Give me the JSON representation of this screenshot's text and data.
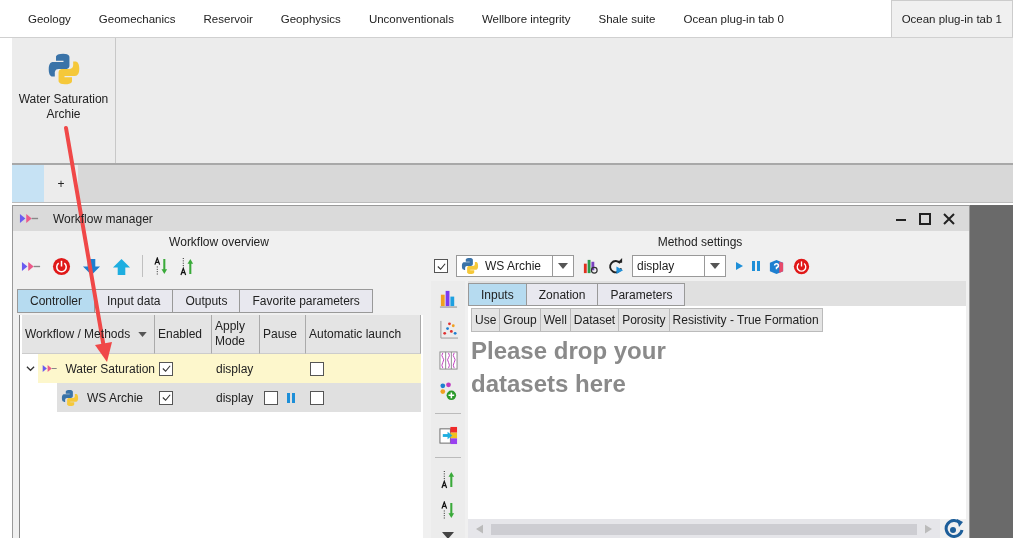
{
  "ribbon_tabs": [
    {
      "label": "Geology",
      "selected": false
    },
    {
      "label": "Geomechanics",
      "selected": false
    },
    {
      "label": "Reservoir",
      "selected": false
    },
    {
      "label": "Geophysics",
      "selected": false
    },
    {
      "label": "Unconventionals",
      "selected": false
    },
    {
      "label": "Wellbore integrity",
      "selected": false
    },
    {
      "label": "Shale suite",
      "selected": false
    },
    {
      "label": "Ocean plug-in tab 0",
      "selected": false
    },
    {
      "label": "Ocean plug-in tab 1",
      "selected": true
    }
  ],
  "ribbon_button": {
    "label": "Water Saturation Archie"
  },
  "document_tabs": {
    "new_tab": "+"
  },
  "workflow_manager": {
    "title": "Workflow manager",
    "overview": {
      "title": "Workflow overview",
      "tabs": [
        {
          "label": "Controller",
          "selected": true
        },
        {
          "label": "Input data",
          "selected": false
        },
        {
          "label": "Outputs",
          "selected": false
        },
        {
          "label": "Favorite parameters",
          "selected": false
        }
      ],
      "columns": [
        "Workflow / Methods",
        "Enabled",
        "Apply Mode",
        "Pause",
        "Automatic launch"
      ],
      "rows": [
        {
          "kind": "workflow",
          "name": "Water Saturation",
          "expanded": true,
          "enabled": true,
          "apply_mode": "display",
          "automatic_launch": false,
          "children": [
            {
              "kind": "method",
              "name": "WS Archie",
              "enabled": true,
              "apply_mode": "display",
              "pause": false,
              "automatic_launch": false
            }
          ]
        }
      ]
    },
    "method_settings": {
      "title": "Method settings",
      "enabled": true,
      "method": "WS Archie",
      "mode": "display",
      "tabs": [
        {
          "label": "Inputs",
          "selected": true
        },
        {
          "label": "Zonation",
          "selected": false
        },
        {
          "label": "Parameters",
          "selected": false
        }
      ],
      "columns": [
        "Use",
        "Group",
        "Well",
        "Dataset",
        "Porosity",
        "Resistivity - True Formation"
      ],
      "drop_hint": "Please drop your datasets here"
    }
  }
}
